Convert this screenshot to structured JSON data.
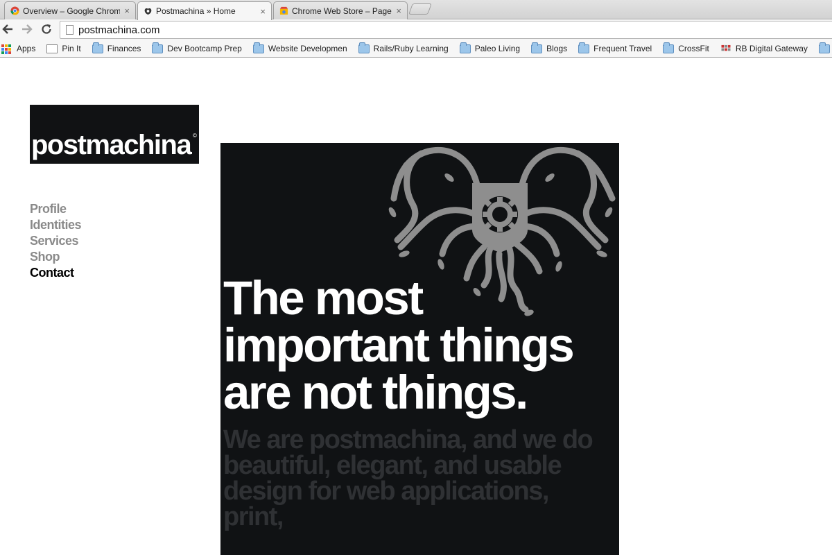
{
  "browser": {
    "tabs": [
      {
        "title": "Overview – Google Chrome",
        "active": false
      },
      {
        "title": "Postmachina » Home",
        "active": true
      },
      {
        "title": "Chrome Web Store – PageS",
        "active": false
      }
    ],
    "url": "postmachina.com",
    "bookmarks": [
      {
        "label": "Apps",
        "icon": "apps-grid-icon"
      },
      {
        "label": "Pin It",
        "icon": "page-icon"
      },
      {
        "label": "Finances",
        "icon": "folder-icon"
      },
      {
        "label": "Dev Bootcamp Prep",
        "icon": "folder-icon"
      },
      {
        "label": "Website Developmen",
        "icon": "folder-icon"
      },
      {
        "label": "Rails/Ruby Learning",
        "icon": "folder-icon"
      },
      {
        "label": "Paleo Living",
        "icon": "folder-icon"
      },
      {
        "label": "Blogs",
        "icon": "folder-icon"
      },
      {
        "label": "Frequent Travel",
        "icon": "folder-icon"
      },
      {
        "label": "CrossFit",
        "icon": "folder-icon"
      },
      {
        "label": "RB Digital Gateway",
        "icon": "favicon-icon"
      }
    ]
  },
  "site": {
    "logo_text": "postmachina",
    "logo_mark": "©",
    "nav": [
      {
        "label": "Profile",
        "current": false
      },
      {
        "label": "Identities",
        "current": false
      },
      {
        "label": "Services",
        "current": false
      },
      {
        "label": "Shop",
        "current": false
      },
      {
        "label": "Contact",
        "current": true
      }
    ],
    "hero": {
      "headline": "The most important things are not things.",
      "subline": "We are postmachina, and we do beautiful, elegant, and usable design for web applications, print,"
    }
  },
  "colors": {
    "hero_bg": "#101214",
    "nav_inactive": "#8a8a8a",
    "nav_active": "#000000",
    "subline": "#2f3134",
    "creature": "#8e8e8e"
  }
}
